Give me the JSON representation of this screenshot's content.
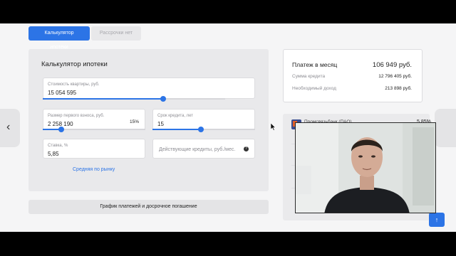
{
  "tabs": [
    {
      "label": "Калькулятор ипотеки",
      "active": true
    },
    {
      "label": "Рассрочки нет",
      "active": false
    }
  ],
  "calculator": {
    "title": "Калькулятор ипотеки",
    "price": {
      "label": "Стоимость квартиры, руб.",
      "value": "15 054 595",
      "slider": 0.66
    },
    "down_payment": {
      "label": "Размер первого взноса, руб.",
      "value": "2 258 190",
      "percent": "15%",
      "slider": 0.18
    },
    "term": {
      "label": "Срок кредита, лет",
      "value": "15",
      "slider": 0.47
    },
    "rate": {
      "label": "Ставка, %",
      "value": "5,85"
    },
    "current_loans": {
      "placeholder": "Действующие кредиты, руб./мес."
    },
    "market_link": "Средняя по рынку"
  },
  "schedule_button": "График платежей и досрочное погашение",
  "summary": {
    "monthly_label": "Платеж в месяц",
    "monthly_value": "106 949 руб.",
    "credit_label": "Сумма кредита",
    "credit_value": "12 796 405 руб.",
    "income_label": "Необходимый доход",
    "income_value": "213 898 руб."
  },
  "bank": {
    "name": "Промсвязьбанк (ПАО)",
    "rate": "5,85%"
  },
  "icons": {
    "prev": "chevron-left-icon",
    "up": "arrow-up-icon",
    "help": "question-icon"
  },
  "colors": {
    "accent": "#2c74e6",
    "panel": "#e9e9eb",
    "background": "#f5f5f6"
  }
}
